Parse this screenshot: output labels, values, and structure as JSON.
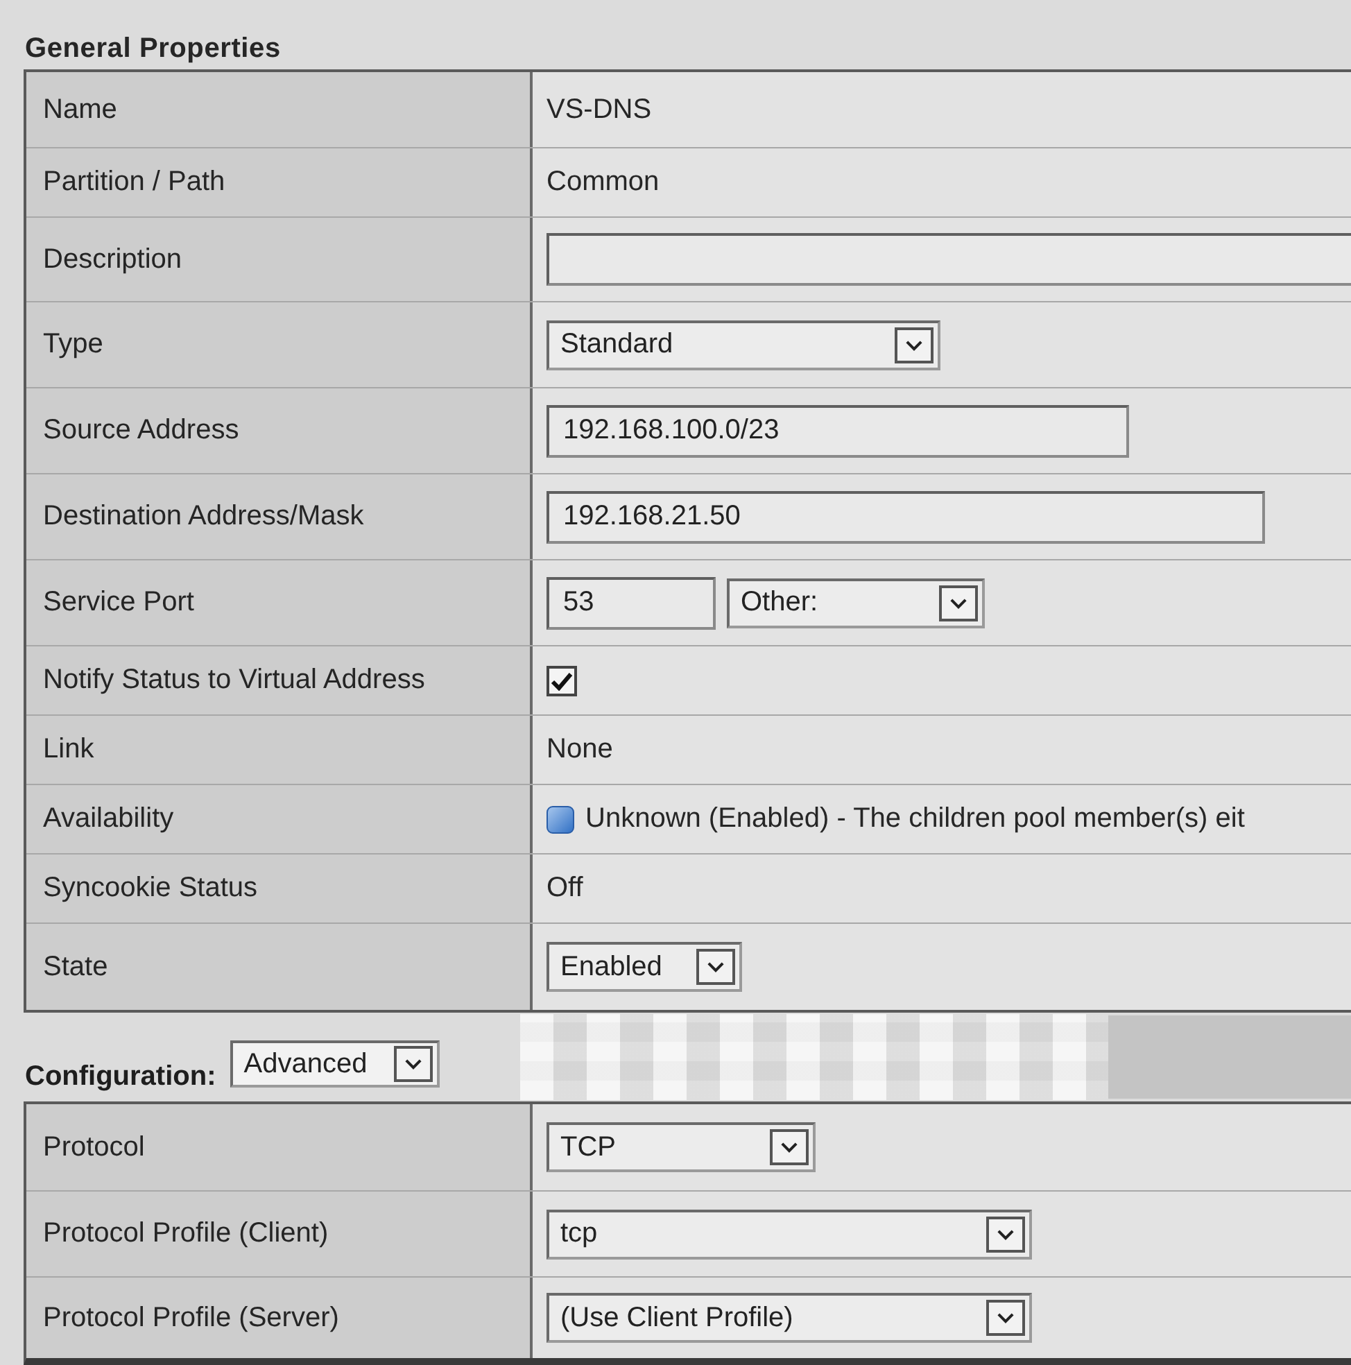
{
  "general_properties": {
    "title": "General Properties",
    "rows": [
      {
        "label": "Name",
        "kind": "text",
        "value": "VS-DNS"
      },
      {
        "label": "Partition / Path",
        "kind": "text",
        "value": "Common"
      },
      {
        "label": "Description",
        "kind": "input"
      },
      {
        "label": "Type",
        "kind": "select",
        "value": "Standard"
      },
      {
        "label": "Source Address",
        "kind": "input",
        "value": "192.168.100.0/23"
      },
      {
        "label": "Destination Address/Mask",
        "kind": "input",
        "value": "192.168.21.50"
      },
      {
        "label": "Service Port",
        "kind": "port",
        "value": "53",
        "option": "Other:"
      },
      {
        "label": "Notify Status to Virtual Address",
        "kind": "checkbox",
        "checked": true
      },
      {
        "label": "Link",
        "kind": "text",
        "value": "None"
      },
      {
        "label": "Availability",
        "kind": "status",
        "value": "Unknown (Enabled) - The children pool member(s) eit"
      },
      {
        "label": "Syncookie Status",
        "kind": "text",
        "value": "Off"
      },
      {
        "label": "State",
        "kind": "select",
        "value": "Enabled"
      }
    ]
  },
  "configuration": {
    "label": "Configuration:",
    "mode": "Advanced",
    "rows": [
      {
        "label": "Protocol",
        "kind": "select",
        "value": "TCP"
      },
      {
        "label": "Protocol Profile (Client)",
        "kind": "select",
        "value": "tcp"
      },
      {
        "label": "Protocol Profile (Server)",
        "kind": "select",
        "value": "(Use Client Profile)"
      }
    ]
  }
}
